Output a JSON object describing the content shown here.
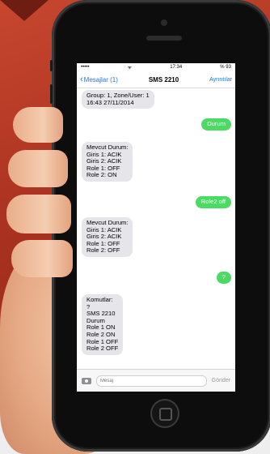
{
  "statusbar": {
    "signal": "•••••",
    "wifi": "ᯤ",
    "time": "17:34",
    "battery": "% 93"
  },
  "nav": {
    "back_label": "Mesajlar (1)",
    "title": "SMS 2210",
    "details_label": "Ayrıntılar"
  },
  "messages": [
    {
      "dir": "in",
      "text": "Group: 1, Zone/User: 1\n16:43 27/11/2014"
    },
    {
      "dir": "out",
      "text": "Durum"
    },
    {
      "dir": "in",
      "text": "Mevcut Durum:\nGiris 1: ACIK\nGiris 2: ACIK\nRole 1: OFF\nRole 2: ON"
    },
    {
      "dir": "out",
      "text": "Role2 off"
    },
    {
      "dir": "in",
      "text": "Mevcut Durum:\nGiris 1: ACIK\nGiris 2: ACIK\nRole 1: OFF\nRole 2: OFF"
    },
    {
      "dir": "out",
      "text": "?"
    },
    {
      "dir": "in",
      "text": "Komutlar:\n?\nSMS 2210\nDurum\nRole 1 ON\nRole 2 ON\nRole 1 OFF\nRole 2 OFF"
    }
  ],
  "input": {
    "placeholder": "Mesaj",
    "send_label": "Gönder"
  },
  "colors": {
    "bubble_out": "#4cd964",
    "bubble_in": "#e5e5ea",
    "link": "#1e74e8"
  }
}
